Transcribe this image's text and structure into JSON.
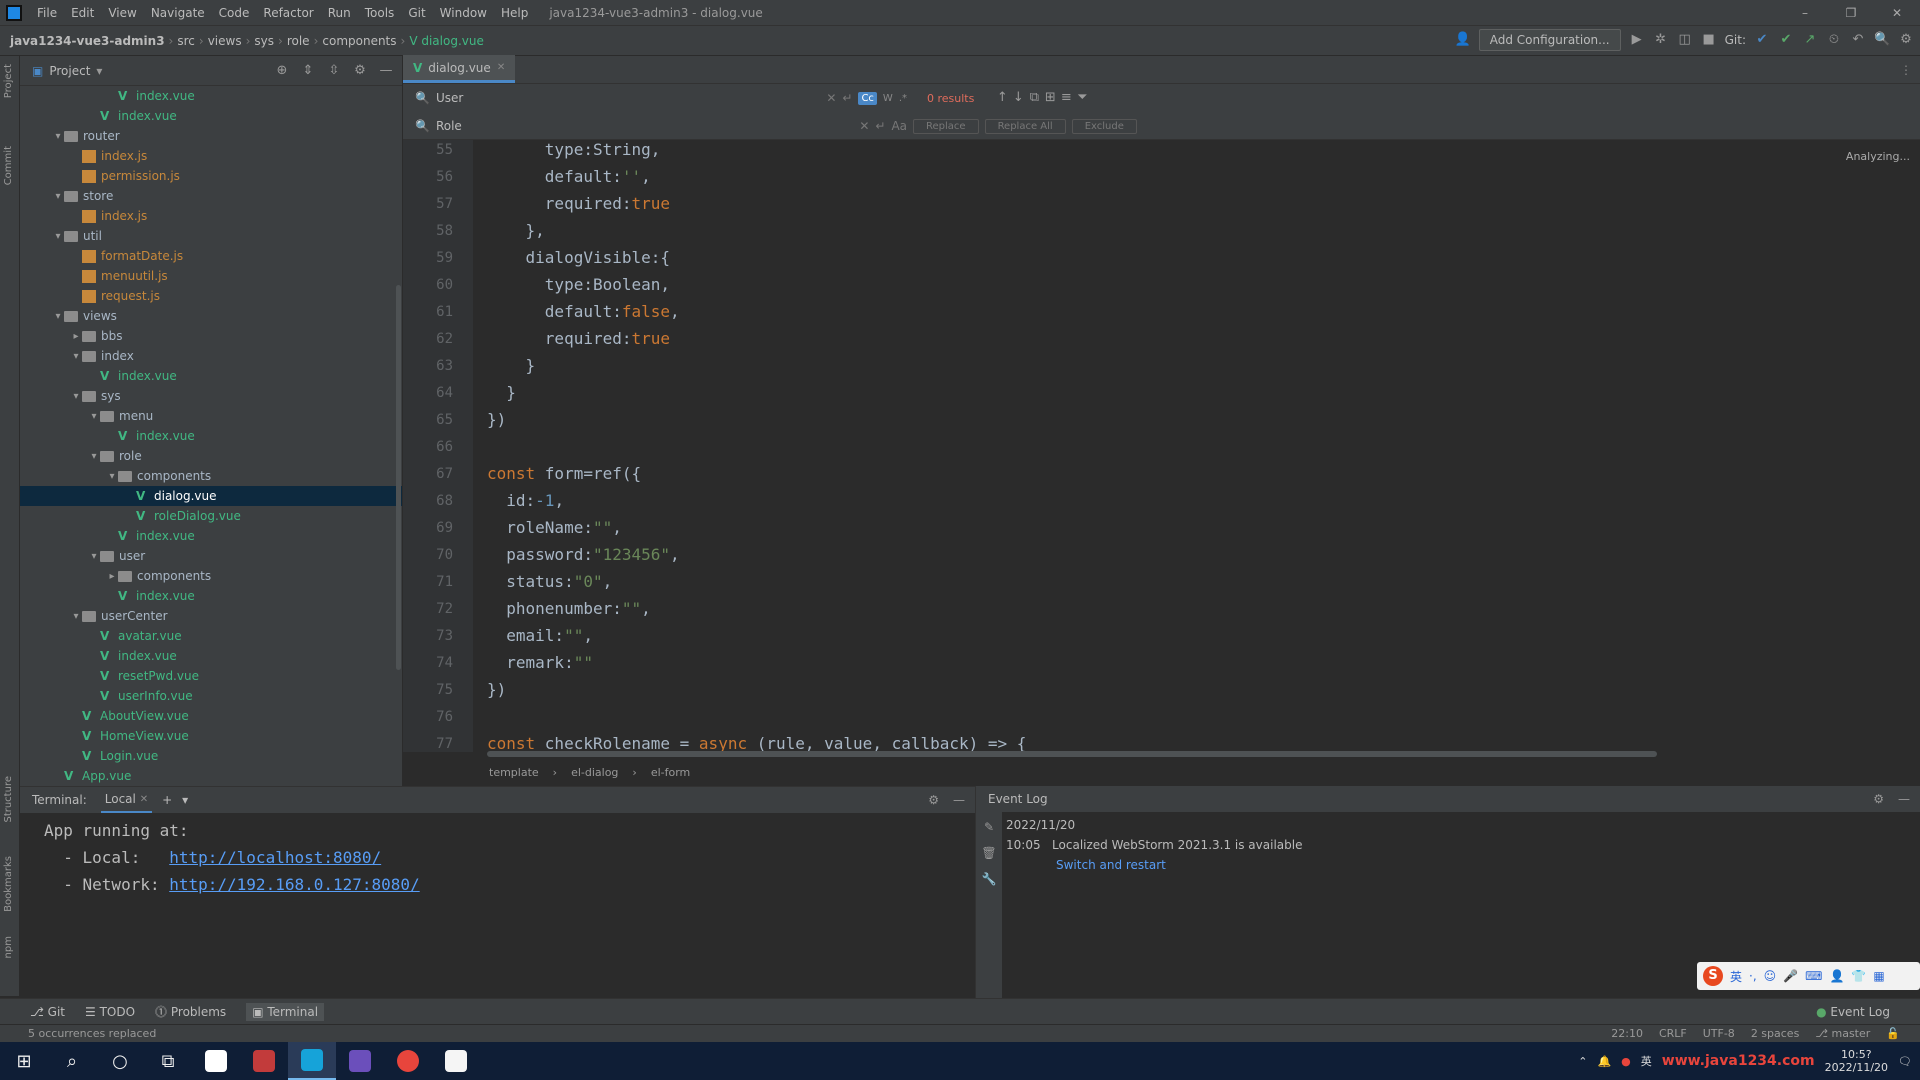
{
  "menubar": {
    "items": [
      "File",
      "Edit",
      "View",
      "Navigate",
      "Code",
      "Refactor",
      "Run",
      "Tools",
      "Git",
      "Window",
      "Help"
    ],
    "title": "java1234-vue3-admin3 - dialog.vue"
  },
  "nav": {
    "crumbs": [
      "java1234-vue3-admin3",
      "src",
      "views",
      "sys",
      "role",
      "components",
      "dialog.vue"
    ],
    "add_config": "Add Configuration...",
    "git_label": "Git:"
  },
  "project": {
    "title": "Project",
    "rows": [
      {
        "d": 5,
        "type": "vue",
        "label": "index.vue"
      },
      {
        "d": 4,
        "type": "vue",
        "label": "index.vue"
      },
      {
        "d": 2,
        "type": "folder",
        "open": true,
        "label": "router"
      },
      {
        "d": 3,
        "type": "js",
        "label": "index.js"
      },
      {
        "d": 3,
        "type": "js",
        "label": "permission.js"
      },
      {
        "d": 2,
        "type": "folder",
        "open": true,
        "label": "store"
      },
      {
        "d": 3,
        "type": "js",
        "label": "index.js"
      },
      {
        "d": 2,
        "type": "folder",
        "open": true,
        "label": "util"
      },
      {
        "d": 3,
        "type": "js",
        "label": "formatDate.js"
      },
      {
        "d": 3,
        "type": "js",
        "label": "menuutil.js"
      },
      {
        "d": 3,
        "type": "js",
        "label": "request.js"
      },
      {
        "d": 2,
        "type": "folder",
        "open": true,
        "label": "views"
      },
      {
        "d": 3,
        "type": "folder",
        "open": false,
        "label": "bbs"
      },
      {
        "d": 3,
        "type": "folder",
        "open": true,
        "label": "index"
      },
      {
        "d": 4,
        "type": "vue",
        "label": "index.vue"
      },
      {
        "d": 3,
        "type": "folder",
        "open": true,
        "label": "sys"
      },
      {
        "d": 4,
        "type": "folder",
        "open": true,
        "label": "menu"
      },
      {
        "d": 5,
        "type": "vue",
        "label": "index.vue"
      },
      {
        "d": 4,
        "type": "folder",
        "open": true,
        "label": "role"
      },
      {
        "d": 5,
        "type": "folder",
        "open": true,
        "label": "components"
      },
      {
        "d": 6,
        "type": "vue",
        "label": "dialog.vue",
        "selected": true
      },
      {
        "d": 6,
        "type": "vue",
        "label": "roleDialog.vue"
      },
      {
        "d": 5,
        "type": "vue",
        "label": "index.vue"
      },
      {
        "d": 4,
        "type": "folder",
        "open": true,
        "label": "user"
      },
      {
        "d": 5,
        "type": "folder",
        "open": false,
        "label": "components"
      },
      {
        "d": 5,
        "type": "vue",
        "label": "index.vue"
      },
      {
        "d": 3,
        "type": "folder",
        "open": true,
        "label": "userCenter"
      },
      {
        "d": 4,
        "type": "vue",
        "label": "avatar.vue"
      },
      {
        "d": 4,
        "type": "vue",
        "label": "index.vue"
      },
      {
        "d": 4,
        "type": "vue",
        "label": "resetPwd.vue"
      },
      {
        "d": 4,
        "type": "vue",
        "label": "userInfo.vue"
      },
      {
        "d": 3,
        "type": "vue",
        "label": "AboutView.vue"
      },
      {
        "d": 3,
        "type": "vue",
        "label": "HomeView.vue"
      },
      {
        "d": 3,
        "type": "vue",
        "label": "Login.vue"
      },
      {
        "d": 2,
        "type": "vue",
        "label": "App.vue"
      }
    ]
  },
  "editor": {
    "tab": "dialog.vue",
    "find": "User",
    "replace": "Role",
    "results": "0 results",
    "btn_replace": "Replace",
    "btn_replace_all": "Replace All",
    "btn_exclude": "Exclude",
    "analyzing": "Analyzing...",
    "lines": [
      {
        "n": "55",
        "seg": [
          [
            "p",
            "      type:String,"
          ]
        ]
      },
      {
        "n": "56",
        "seg": [
          [
            "p",
            "      default:"
          ],
          [
            "s",
            "''"
          ],
          [
            "p",
            ","
          ]
        ]
      },
      {
        "n": "57",
        "seg": [
          [
            "p",
            "      required:"
          ],
          [
            "k",
            "true"
          ]
        ]
      },
      {
        "n": "58",
        "seg": [
          [
            "p",
            "    },"
          ]
        ]
      },
      {
        "n": "59",
        "seg": [
          [
            "p",
            "    dialogVisible:{"
          ]
        ]
      },
      {
        "n": "60",
        "seg": [
          [
            "p",
            "      type:Boolean,"
          ]
        ]
      },
      {
        "n": "61",
        "seg": [
          [
            "p",
            "      default:"
          ],
          [
            "k",
            "false"
          ],
          [
            "p",
            ","
          ]
        ]
      },
      {
        "n": "62",
        "seg": [
          [
            "p",
            "      required:"
          ],
          [
            "k",
            "true"
          ]
        ]
      },
      {
        "n": "63",
        "seg": [
          [
            "p",
            "    }"
          ]
        ]
      },
      {
        "n": "64",
        "seg": [
          [
            "p",
            "  }"
          ]
        ]
      },
      {
        "n": "65",
        "seg": [
          [
            "p",
            "})"
          ]
        ]
      },
      {
        "n": "66",
        "seg": [
          [
            "p",
            ""
          ]
        ]
      },
      {
        "n": "67",
        "seg": [
          [
            "k",
            "const "
          ],
          [
            "p",
            "form=ref({"
          ]
        ]
      },
      {
        "n": "68",
        "seg": [
          [
            "p",
            "  id:"
          ],
          [
            "n",
            "-1"
          ],
          [
            "p",
            ","
          ]
        ]
      },
      {
        "n": "69",
        "seg": [
          [
            "p",
            "  roleName:"
          ],
          [
            "s",
            "\"\""
          ],
          [
            "p",
            ","
          ]
        ]
      },
      {
        "n": "70",
        "seg": [
          [
            "p",
            "  password:"
          ],
          [
            "s",
            "\"123456\""
          ],
          [
            "p",
            ","
          ]
        ]
      },
      {
        "n": "71",
        "seg": [
          [
            "p",
            "  status:"
          ],
          [
            "s",
            "\"0\""
          ],
          [
            "p",
            ","
          ]
        ]
      },
      {
        "n": "72",
        "seg": [
          [
            "p",
            "  phonenumber:"
          ],
          [
            "s",
            "\"\""
          ],
          [
            "p",
            ","
          ]
        ]
      },
      {
        "n": "73",
        "seg": [
          [
            "p",
            "  email:"
          ],
          [
            "s",
            "\"\""
          ],
          [
            "p",
            ","
          ]
        ]
      },
      {
        "n": "74",
        "seg": [
          [
            "p",
            "  remark:"
          ],
          [
            "s",
            "\"\""
          ]
        ]
      },
      {
        "n": "75",
        "seg": [
          [
            "p",
            "})"
          ]
        ]
      },
      {
        "n": "76",
        "seg": [
          [
            "p",
            ""
          ]
        ]
      },
      {
        "n": "77",
        "seg": [
          [
            "k",
            "const "
          ],
          [
            "p",
            "checkRolename = "
          ],
          [
            "k",
            "async "
          ],
          [
            "p",
            "(rule, value, callback) => {"
          ]
        ]
      }
    ],
    "breadcrumb": [
      "template",
      "el-dialog",
      "el-form"
    ]
  },
  "terminal": {
    "tab_title": "Terminal:",
    "tab_local": "Local",
    "line1": "App running at:",
    "local_label": "  - Local:   ",
    "local_url": "http://localhost:8080/",
    "net_label": "  - Network: ",
    "net_url": "http://192.168.0.127:8080/"
  },
  "eventlog": {
    "title": "Event Log",
    "date": "2022/11/20",
    "time": "10:05",
    "msg": "Localized WebStorm 2021.3.1 is available",
    "link": "Switch and restart"
  },
  "toolwin": {
    "git": "Git",
    "todo": "TODO",
    "problems": "Problems",
    "terminal": "Terminal",
    "eventlog": "Event Log"
  },
  "status": {
    "msg": "5 occurrences replaced",
    "pos": "22:10",
    "crlf": "CRLF",
    "enc": "UTF-8",
    "indent": "2 spaces",
    "branch": "master"
  },
  "taskbar": {
    "time": "10:5?",
    "date": "2022/11/20",
    "watermark": "www.java1234.com"
  }
}
